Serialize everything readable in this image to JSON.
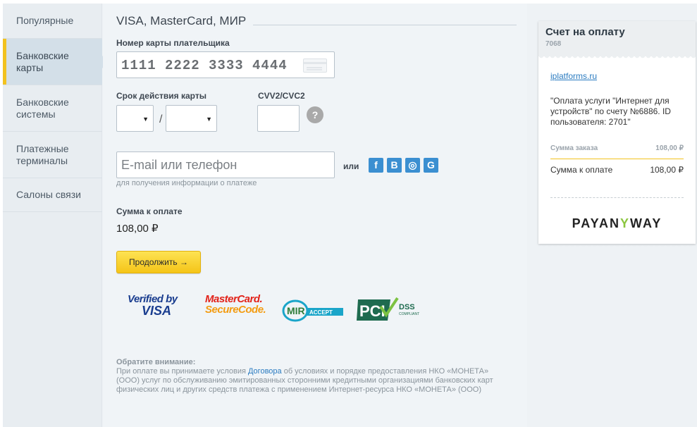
{
  "sidebar": {
    "items": [
      {
        "label": "Популярные"
      },
      {
        "label": "Банковские карты"
      },
      {
        "label": "Банковские системы"
      },
      {
        "label": "Платежные терминалы"
      },
      {
        "label": "Салоны связи"
      }
    ],
    "active_index": 1
  },
  "form": {
    "section_title": "VISA, MasterCard, МИР",
    "card_number_label": "Номер карты плательщика",
    "card_number_value": "1111 2222 3333 4444",
    "expiry_label": "Срок действия карты",
    "expiry_separator": "/",
    "cvv_label": "CVV2/CVC2",
    "help_symbol": "?",
    "email_placeholder": "E-mail или телефон",
    "email_hint": "для получения информации о платеже",
    "or_label": "или",
    "social": [
      "f",
      "В",
      "◎",
      "G"
    ],
    "total_label": "Сумма к оплате",
    "total_value": "108,00 ₽",
    "continue_button": "Продолжить →"
  },
  "security_logos": {
    "verified_by_visa_line1": "Verified by",
    "verified_by_visa_line2": "VISA",
    "mastercard_line1": "MasterCard.",
    "mastercard_line2": "SecureCode.",
    "mir_text": "MIR",
    "mir_accept": "ACCEPT",
    "pci_text": "PCI",
    "pci_dss": "DSS",
    "pci_compliant": "COMPLIANT"
  },
  "notice": {
    "title": "Обратите внимание:",
    "text_before_link": "При оплате вы принимаете условия ",
    "link_text": "Договора",
    "text_after_link": " об условиях и порядке предоставления НКО «МОНЕТА» (ООО) услуг по обслуживанию эмитированных сторонними кредитными организациями банковских карт физических лиц и других средств платежа с применением Интернет-ресурса НКО «МОНЕТА» (ООО)"
  },
  "invoice": {
    "title": "Счет на оплату",
    "number": "7068",
    "merchant_link": "iplatforms.ru",
    "description": "\"Оплата услуги \"Интернет для устройств\" по счету №6886. ID пользователя: 2701\"",
    "order_sum_label": "Сумма заказа",
    "order_sum_value": "108,00 ₽",
    "pay_sum_label": "Сумма к оплате",
    "pay_sum_value": "108,00 ₽",
    "brand_part1": "PAYAN",
    "brand_y": "Y",
    "brand_part2": "WAY"
  },
  "colors": {
    "accent_yellow": "#f2c21f",
    "link_blue": "#2a7bc0",
    "social_blue": "#3b8fd1"
  }
}
